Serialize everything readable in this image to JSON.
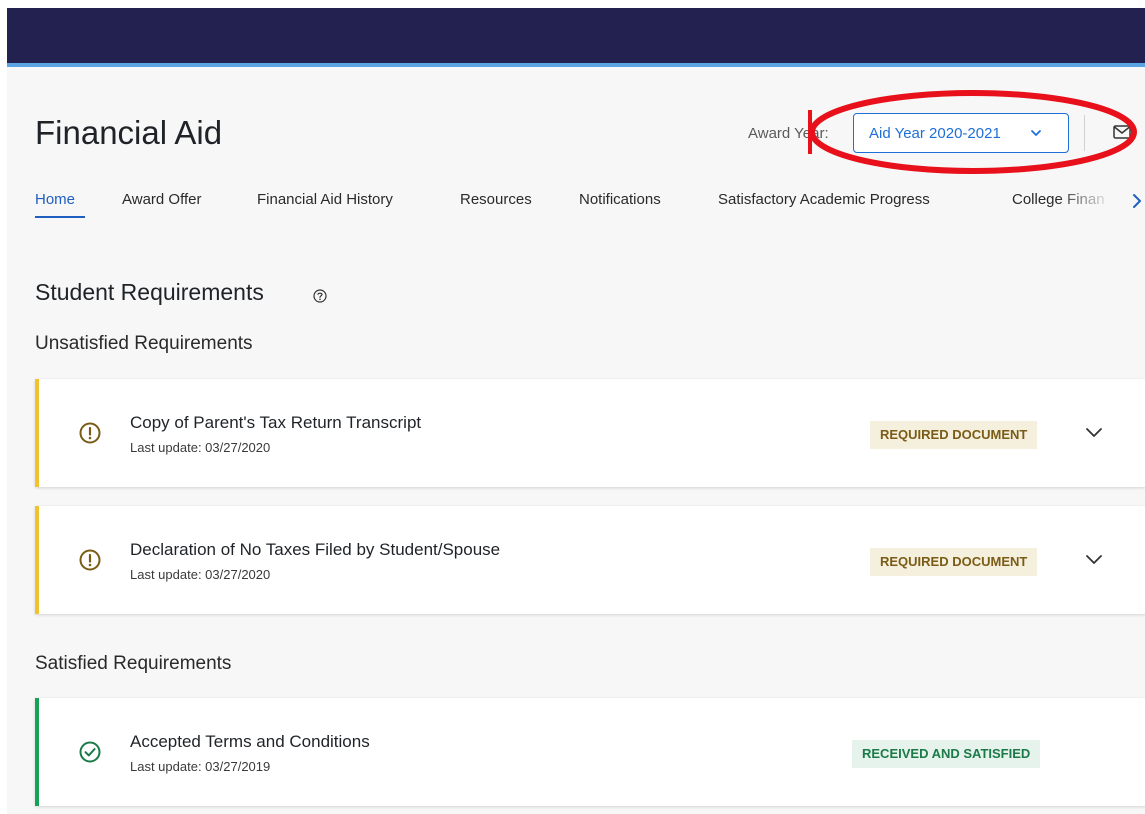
{
  "page": {
    "title": "Financial Aid"
  },
  "award_year": {
    "label": "Award Year:",
    "selected": "Aid Year 2020-2021"
  },
  "tabs": [
    {
      "label": "Home",
      "active": true
    },
    {
      "label": "Award Offer",
      "active": false
    },
    {
      "label": "Financial Aid History",
      "active": false
    },
    {
      "label": "Resources",
      "active": false
    },
    {
      "label": "Notifications",
      "active": false
    },
    {
      "label": "Satisfactory Academic Progress",
      "active": false
    },
    {
      "label": "College Finan",
      "active": false
    }
  ],
  "requirements": {
    "title": "Student Requirements",
    "unsatisfied_title": "Unsatisfied Requirements",
    "satisfied_title": "Satisfied Requirements",
    "unsatisfied": [
      {
        "name": "Copy of Parent's Tax Return Transcript",
        "last_update": "Last update: 03/27/2020",
        "status": "REQUIRED DOCUMENT"
      },
      {
        "name": "Declaration of No Taxes Filed by Student/Spouse",
        "last_update": "Last update: 03/27/2020",
        "status": "REQUIRED DOCUMENT"
      }
    ],
    "satisfied": [
      {
        "name": "Accepted Terms and Conditions",
        "last_update": "Last update: 03/27/2019",
        "status": "RECEIVED AND SATISFIED"
      }
    ]
  },
  "colors": {
    "header": "#22214f",
    "header_accent": "#5ba4e4",
    "link": "#1e6fd9",
    "warning": "#f2c12e",
    "success": "#17a355",
    "annotation": "#e8101a"
  }
}
